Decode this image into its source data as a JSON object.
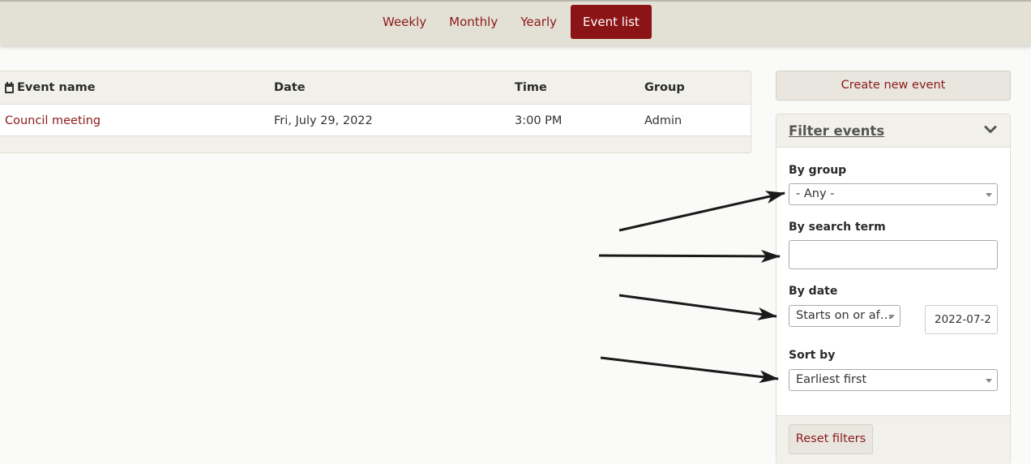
{
  "nav": {
    "tabs": [
      {
        "label": "Weekly"
      },
      {
        "label": "Monthly"
      },
      {
        "label": "Yearly"
      },
      {
        "label": "Event list",
        "active": true
      }
    ]
  },
  "table": {
    "columns": {
      "event_name": "Event name",
      "date": "Date",
      "time": "Time",
      "group": "Group"
    },
    "rows": [
      {
        "event_name": "Council meeting",
        "date": "Fri, July 29, 2022",
        "time": "3:00 PM",
        "group": "Admin"
      }
    ]
  },
  "sidebar": {
    "create_button": "Create new event",
    "filter": {
      "title": "Filter events",
      "by_group_label": "By group",
      "by_group_value": "- Any -",
      "by_search_label": "By search term",
      "by_search_value": "",
      "by_date_label": "By date",
      "by_date_mode": "Starts on or af…",
      "by_date_value": "2022-07-2",
      "sort_label": "Sort by",
      "sort_value": "Earliest first",
      "reset_button": "Reset filters"
    }
  },
  "colors": {
    "accent": "#8b1416",
    "link": "#8b1a1a",
    "bar": "#e3e0d5"
  }
}
